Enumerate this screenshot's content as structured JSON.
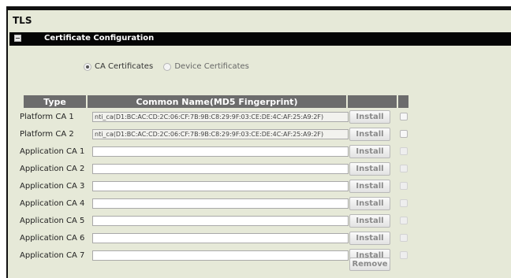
{
  "page": {
    "title": "TLS"
  },
  "section": {
    "title": "Certificate Configuration"
  },
  "cert_type": {
    "options": [
      {
        "label": "CA Certificates",
        "selected": true
      },
      {
        "label": "Device Certificates",
        "selected": false
      }
    ]
  },
  "table": {
    "headers": [
      "Type",
      "Common Name(MD5 Fingerprint)",
      "",
      ""
    ],
    "rows": [
      {
        "type": "Platform CA 1",
        "common_name": "nti_ca(D1:BC:AC:CD:2C:06:CF:7B:9B:C8:29:9F:03:CE:DE:4C:AF:25:A9:2F)",
        "install": "Install",
        "checkbox_enabled": true
      },
      {
        "type": "Platform CA 2",
        "common_name": "nti_ca(D1:BC:AC:CD:2C:06:CF:7B:9B:C8:29:9F:03:CE:DE:4C:AF:25:A9:2F)",
        "install": "Install",
        "checkbox_enabled": true
      },
      {
        "type": "Application CA 1",
        "common_name": "",
        "install": "Install",
        "checkbox_enabled": false
      },
      {
        "type": "Application CA 2",
        "common_name": "",
        "install": "Install",
        "checkbox_enabled": false
      },
      {
        "type": "Application CA 3",
        "common_name": "",
        "install": "Install",
        "checkbox_enabled": false
      },
      {
        "type": "Application CA 4",
        "common_name": "",
        "install": "Install",
        "checkbox_enabled": false
      },
      {
        "type": "Application CA 5",
        "common_name": "",
        "install": "Install",
        "checkbox_enabled": false
      },
      {
        "type": "Application CA 6",
        "common_name": "",
        "install": "Install",
        "checkbox_enabled": false
      },
      {
        "type": "Application CA 7",
        "common_name": "",
        "install": "Install",
        "checkbox_enabled": false
      }
    ],
    "remove_label": "Remove"
  }
}
